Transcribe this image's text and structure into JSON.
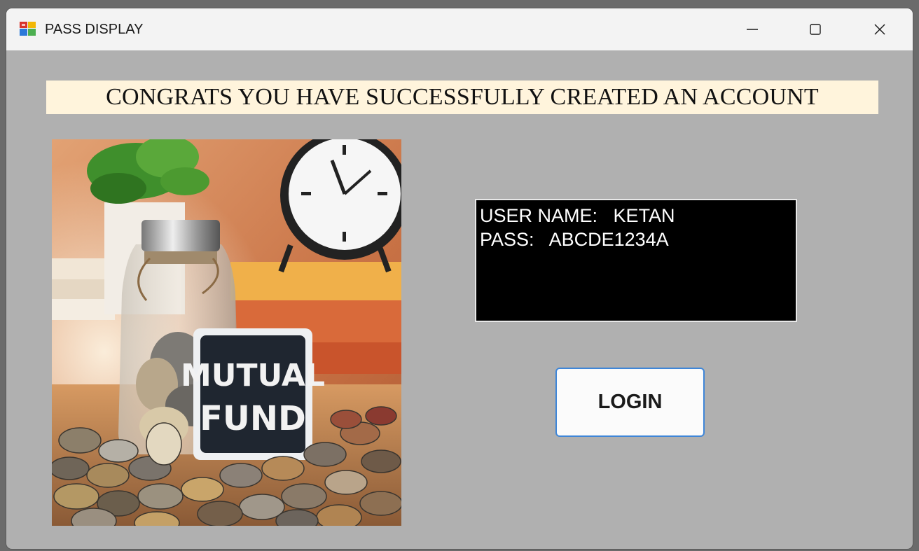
{
  "window": {
    "title": "PASS DISPLAY",
    "icons": {
      "app": "windows-form-icon",
      "minimize": "minimize-icon",
      "maximize": "maximize-icon",
      "close": "close-icon"
    }
  },
  "banner": {
    "text": "CONGRATS YOU HAVE SUCCESSFULLY CREATED AN ACCOUNT"
  },
  "image": {
    "sign_line1": "MUTUAL",
    "sign_line2": "FUND"
  },
  "credentials": {
    "username_label": "USER NAME:",
    "username_value": "KETAN",
    "password_label": "PASS:",
    "password_value": "ABCDE1234A"
  },
  "login_button": {
    "label": "LOGIN"
  },
  "colors": {
    "window_bg": "#b0b0b0",
    "banner_bg": "#fff4dc",
    "button_border": "#3f86d8"
  }
}
